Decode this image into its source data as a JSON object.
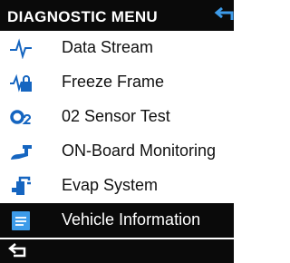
{
  "header": {
    "title": "DIAGNOSTIC MENU",
    "back_icon": "back-arrow-icon"
  },
  "menu": {
    "items": [
      {
        "label": "Data Stream",
        "icon": "waveform-icon"
      },
      {
        "label": "Freeze Frame",
        "icon": "freeze-frame-icon"
      },
      {
        "label": "02 Sensor Test",
        "icon": "o2-sensor-icon"
      },
      {
        "label": "ON-Board Monitoring",
        "icon": "onboard-monitor-icon"
      },
      {
        "label": "Evap System",
        "icon": "evap-pump-icon"
      },
      {
        "label": "Vehicle Information",
        "icon": "document-icon",
        "selected": true
      }
    ]
  },
  "footer": {
    "back_icon": "back-arrow-icon"
  },
  "colors": {
    "icon_blue": "#1565c0",
    "bar": "#0a0a0a",
    "selected_icon": "#3d9be9"
  }
}
